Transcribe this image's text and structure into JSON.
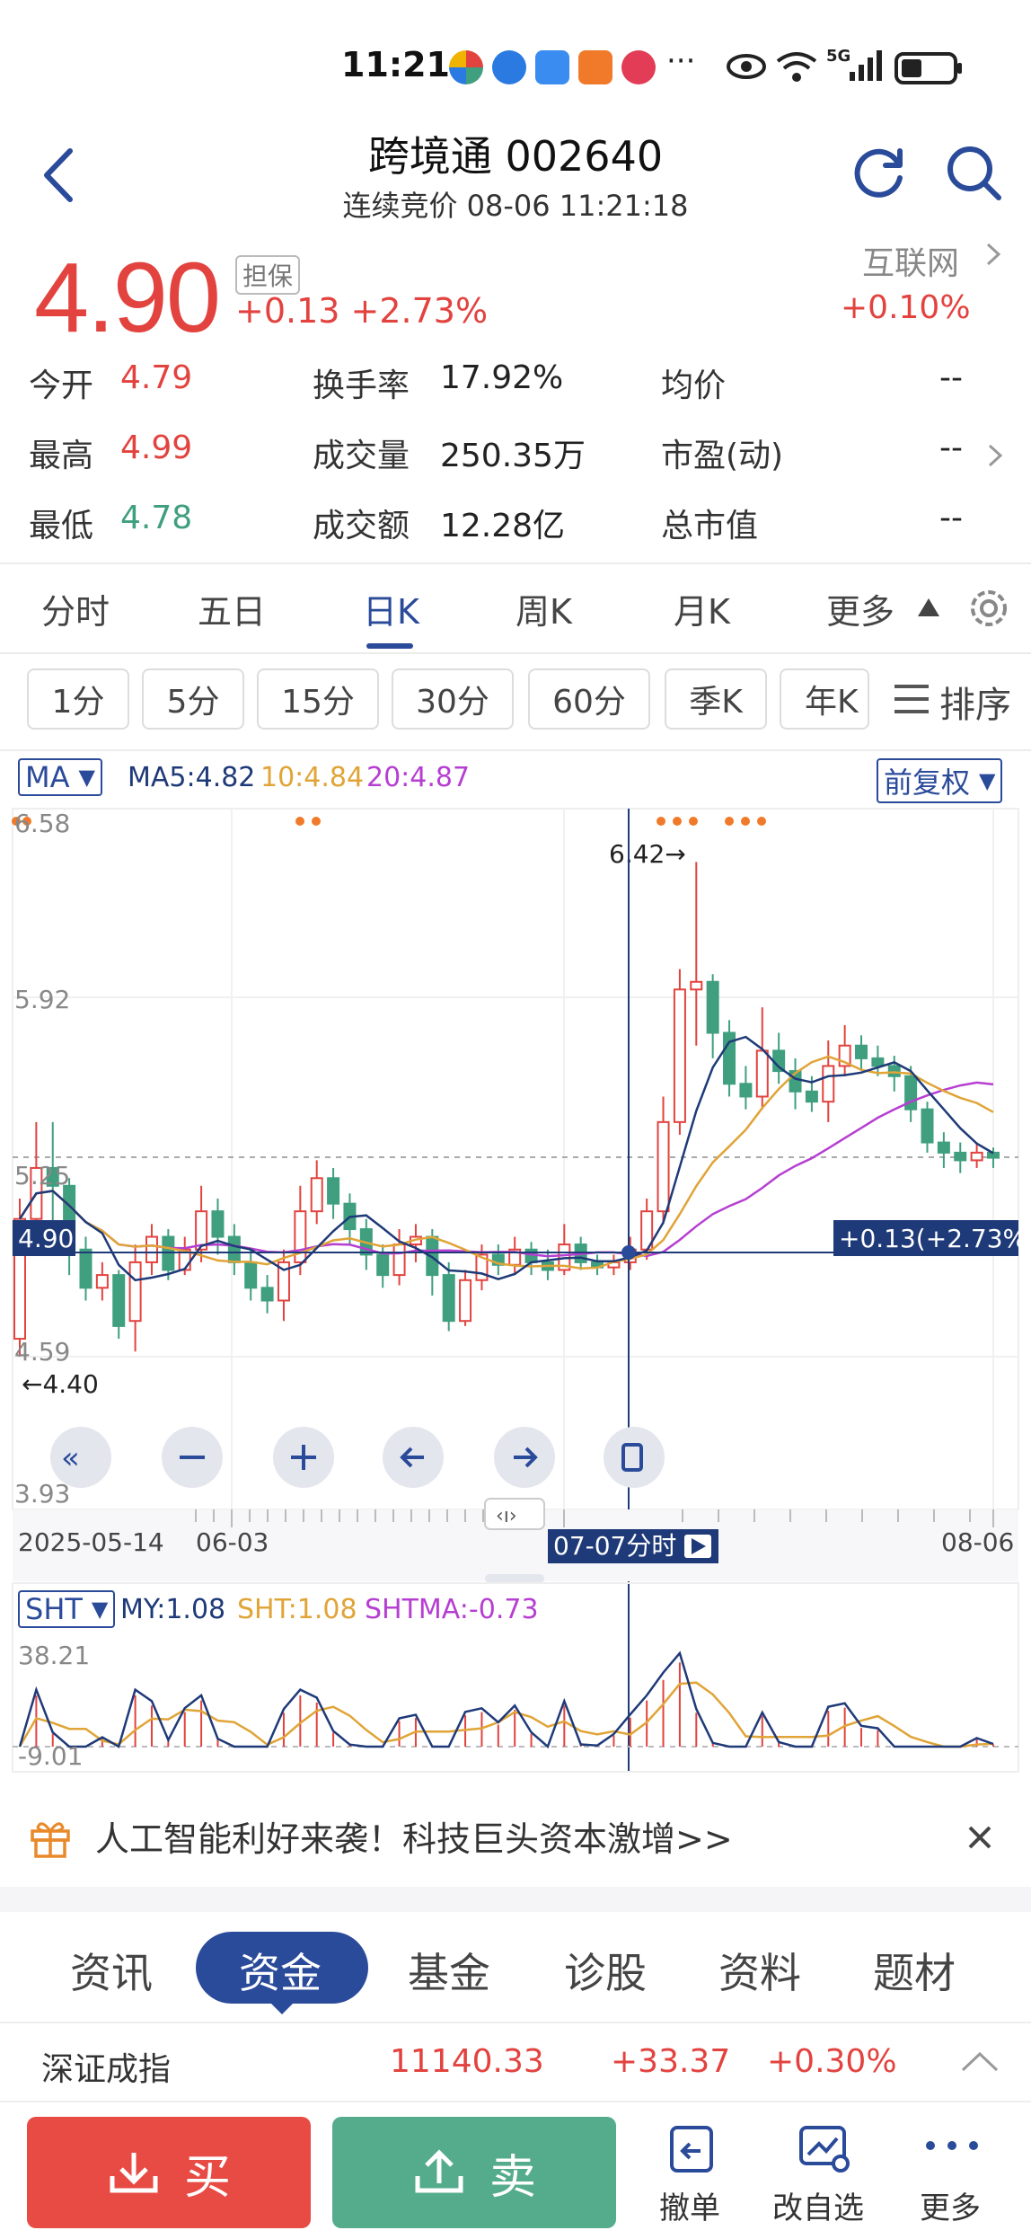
{
  "status": {
    "time": "11:21",
    "more": "···",
    "net": "5G"
  },
  "header": {
    "title": "跨境通 002640",
    "subtitle": "连续竞价 08-06 11:21:18"
  },
  "price": {
    "last": "4.90",
    "tag": "担保",
    "change": "+0.13 +2.73%",
    "sector_name": "互联网",
    "sector_change": "+0.10%"
  },
  "quote": {
    "rows": [
      [
        {
          "label": "今开",
          "value": "4.79"
        },
        {
          "label": "换手率",
          "value": "17.92%"
        },
        {
          "label": "均价",
          "value": "--"
        }
      ],
      [
        {
          "label": "最高",
          "value": "4.99"
        },
        {
          "label": "成交量",
          "value": "250.35万"
        },
        {
          "label": "市盈(动)",
          "value": "--"
        }
      ],
      [
        {
          "label": "最低",
          "value": "4.78"
        },
        {
          "label": "成交额",
          "value": "12.28亿"
        },
        {
          "label": "总市值",
          "value": "--"
        }
      ]
    ]
  },
  "ktabs": [
    "分时",
    "五日",
    "日K",
    "周K",
    "月K",
    "更多"
  ],
  "periods": [
    "1分",
    "5分",
    "15分",
    "30分",
    "60分",
    "季K",
    "年K"
  ],
  "sort_label": "排序",
  "chart": {
    "ma_selector": "MA",
    "ma5": "MA5:4.82",
    "ma10": "10:4.84",
    "ma20": "20:4.87",
    "adjust": "前复权",
    "y_labels": [
      "6.58",
      "5.92",
      "5.25",
      "4.59",
      "3.93"
    ],
    "high_label": "6.42→",
    "low_label": "←4.40",
    "cursor_price": "4.90",
    "cursor_change": "+0.13(+2.73%)",
    "dates": [
      "2025-05-14",
      "06-03",
      "08-06"
    ],
    "cursor_date": "07-07分时",
    "sht_selector": "SHT",
    "my": "MY:1.08",
    "sht": "SHT:1.08",
    "shtma": "SHTMA:-0.73",
    "sht_top": "38.21",
    "sht_bottom": "-9.01",
    "colors": {
      "up": "#e2433f",
      "down": "#3f9f7e",
      "ma5": "#1f3a78",
      "ma10": "#e0a437",
      "ma20": "#b63fd1"
    }
  },
  "chart_data": {
    "type": "candlestick",
    "ylim": [
      3.93,
      6.58
    ],
    "candles": [
      {
        "o": 4.55,
        "c": 5.02,
        "h": 5.1,
        "l": 4.48
      },
      {
        "o": 5.02,
        "c": 5.22,
        "h": 5.4,
        "l": 4.98
      },
      {
        "o": 5.22,
        "c": 5.15,
        "h": 5.4,
        "l": 4.95
      },
      {
        "o": 5.15,
        "c": 4.9,
        "h": 5.18,
        "l": 4.8
      },
      {
        "o": 4.9,
        "c": 4.75,
        "h": 4.95,
        "l": 4.7
      },
      {
        "o": 4.75,
        "c": 4.8,
        "h": 4.85,
        "l": 4.7
      },
      {
        "o": 4.8,
        "c": 4.6,
        "h": 4.82,
        "l": 4.55
      },
      {
        "o": 4.62,
        "c": 4.85,
        "h": 4.92,
        "l": 4.5
      },
      {
        "o": 4.85,
        "c": 4.95,
        "h": 5.0,
        "l": 4.8
      },
      {
        "o": 4.95,
        "c": 4.82,
        "h": 4.98,
        "l": 4.78
      },
      {
        "o": 4.82,
        "c": 4.9,
        "h": 4.95,
        "l": 4.8
      },
      {
        "o": 4.9,
        "c": 5.05,
        "h": 5.15,
        "l": 4.85
      },
      {
        "o": 5.05,
        "c": 4.95,
        "h": 5.1,
        "l": 4.88
      },
      {
        "o": 4.95,
        "c": 4.85,
        "h": 5.0,
        "l": 4.8
      },
      {
        "o": 4.85,
        "c": 4.75,
        "h": 4.9,
        "l": 4.7
      },
      {
        "o": 4.75,
        "c": 4.7,
        "h": 4.8,
        "l": 4.65
      },
      {
        "o": 4.7,
        "c": 4.85,
        "h": 4.9,
        "l": 4.62
      },
      {
        "o": 4.85,
        "c": 5.05,
        "h": 5.15,
        "l": 4.8
      },
      {
        "o": 5.05,
        "c": 5.18,
        "h": 5.25,
        "l": 5.0
      },
      {
        "o": 5.18,
        "c": 5.08,
        "h": 5.22,
        "l": 5.02
      },
      {
        "o": 5.08,
        "c": 4.98,
        "h": 5.12,
        "l": 4.92
      },
      {
        "o": 4.98,
        "c": 4.88,
        "h": 5.02,
        "l": 4.82
      },
      {
        "o": 4.88,
        "c": 4.8,
        "h": 4.92,
        "l": 4.75
      },
      {
        "o": 4.8,
        "c": 4.92,
        "h": 4.98,
        "l": 4.76
      },
      {
        "o": 4.92,
        "c": 4.95,
        "h": 5.0,
        "l": 4.85
      },
      {
        "o": 4.95,
        "c": 4.8,
        "h": 4.98,
        "l": 4.72
      },
      {
        "o": 4.8,
        "c": 4.62,
        "h": 4.85,
        "l": 4.58
      },
      {
        "o": 4.62,
        "c": 4.78,
        "h": 4.82,
        "l": 4.6
      },
      {
        "o": 4.78,
        "c": 4.88,
        "h": 4.92,
        "l": 4.74
      },
      {
        "o": 4.88,
        "c": 4.84,
        "h": 4.92,
        "l": 4.8
      },
      {
        "o": 4.84,
        "c": 4.9,
        "h": 4.95,
        "l": 4.8
      },
      {
        "o": 4.9,
        "c": 4.85,
        "h": 4.93,
        "l": 4.8
      },
      {
        "o": 4.85,
        "c": 4.82,
        "h": 4.9,
        "l": 4.78
      },
      {
        "o": 4.82,
        "c": 4.92,
        "h": 5.0,
        "l": 4.8
      },
      {
        "o": 4.92,
        "c": 4.85,
        "h": 4.95,
        "l": 4.82
      },
      {
        "o": 4.85,
        "c": 4.83,
        "h": 4.88,
        "l": 4.8
      },
      {
        "o": 4.83,
        "c": 4.85,
        "h": 4.88,
        "l": 4.8
      },
      {
        "o": 4.85,
        "c": 4.9,
        "h": 4.95,
        "l": 4.82
      },
      {
        "o": 4.9,
        "c": 5.05,
        "h": 5.1,
        "l": 4.86
      },
      {
        "o": 5.05,
        "c": 5.4,
        "h": 5.5,
        "l": 5.0
      },
      {
        "o": 5.4,
        "c": 5.92,
        "h": 6.0,
        "l": 5.35
      },
      {
        "o": 5.92,
        "c": 5.95,
        "h": 6.42,
        "l": 5.7
      },
      {
        "o": 5.95,
        "c": 5.75,
        "h": 5.98,
        "l": 5.65
      },
      {
        "o": 5.75,
        "c": 5.55,
        "h": 5.8,
        "l": 5.5
      },
      {
        "o": 5.55,
        "c": 5.5,
        "h": 5.62,
        "l": 5.45
      },
      {
        "o": 5.5,
        "c": 5.68,
        "h": 5.85,
        "l": 5.45
      },
      {
        "o": 5.68,
        "c": 5.6,
        "h": 5.75,
        "l": 5.55
      },
      {
        "o": 5.6,
        "c": 5.52,
        "h": 5.65,
        "l": 5.45
      },
      {
        "o": 5.52,
        "c": 5.48,
        "h": 5.58,
        "l": 5.44
      },
      {
        "o": 5.48,
        "c": 5.62,
        "h": 5.72,
        "l": 5.4
      },
      {
        "o": 5.62,
        "c": 5.7,
        "h": 5.78,
        "l": 5.58
      },
      {
        "o": 5.7,
        "c": 5.65,
        "h": 5.74,
        "l": 5.6
      },
      {
        "o": 5.65,
        "c": 5.62,
        "h": 5.7,
        "l": 5.58
      },
      {
        "o": 5.62,
        "c": 5.58,
        "h": 5.66,
        "l": 5.52
      },
      {
        "o": 5.58,
        "c": 5.45,
        "h": 5.62,
        "l": 5.4
      },
      {
        "o": 5.45,
        "c": 5.32,
        "h": 5.48,
        "l": 5.28
      },
      {
        "o": 5.32,
        "c": 5.28,
        "h": 5.36,
        "l": 5.22
      },
      {
        "o": 5.28,
        "c": 5.25,
        "h": 5.32,
        "l": 5.2
      },
      {
        "o": 5.25,
        "c": 5.28,
        "h": 5.32,
        "l": 5.22
      },
      {
        "o": 5.28,
        "c": 5.26,
        "h": 5.3,
        "l": 5.22
      }
    ]
  },
  "banner": {
    "text": "人工智能利好来袭！科技巨头资本激增>>"
  },
  "info_tabs": [
    "资讯",
    "资金",
    "基金",
    "诊股",
    "资料",
    "题材"
  ],
  "index": {
    "name": "深证成指",
    "value": "11140.33",
    "change": "+33.37",
    "pct": "+0.30%"
  },
  "bottom": {
    "buy": "买",
    "sell": "卖",
    "cancel": "撤单",
    "edit": "改自选",
    "more": "更多"
  }
}
